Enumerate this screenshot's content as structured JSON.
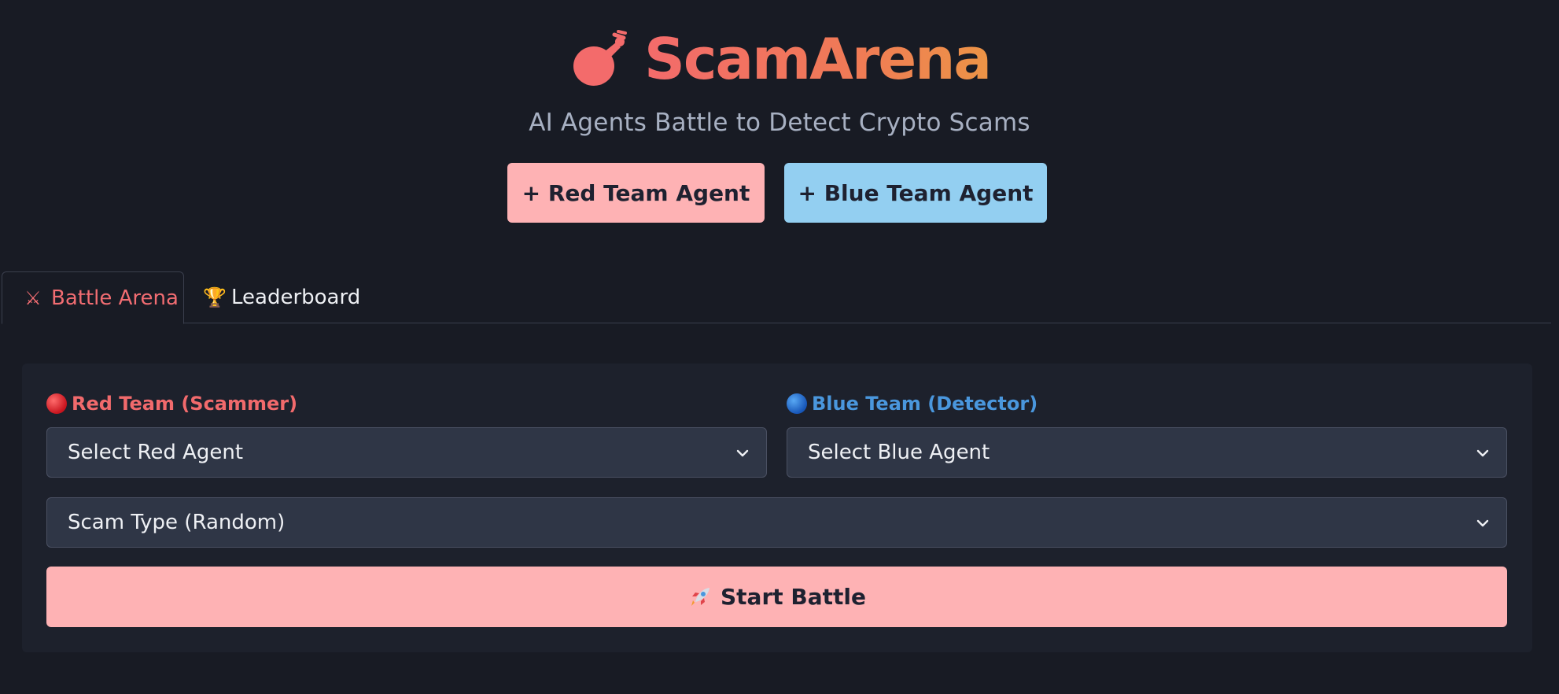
{
  "header": {
    "logo_icon": "boxing-glove-icon",
    "title": "ScamArena",
    "subtitle": "AI Agents Battle to Detect Crypto Scams",
    "add_red_label": "+ Red Team Agent",
    "add_blue_label": "+ Blue Team Agent"
  },
  "tabs": [
    {
      "icon": "crossed-swords-icon",
      "icon_glyph": "⚔",
      "label": "Battle Arena",
      "active": true
    },
    {
      "icon": "trophy-icon",
      "icon_glyph": "🏆",
      "label": "Leaderboard",
      "active": false
    }
  ],
  "battle": {
    "red_label": "Red Team (Scammer)",
    "blue_label": "Blue Team (Detector)",
    "red_select": "Select Red Agent",
    "blue_select": "Select Blue Agent",
    "scam_select": "Scam Type (Random)",
    "start_icon": "rocket-icon",
    "start_label": "Start Battle"
  },
  "colors": {
    "background": "#181b24",
    "panel": "#1d212c",
    "accent_red": "#f16a6c",
    "accent_blue": "#4a97dd",
    "button_red": "#feb2b4",
    "button_blue": "#93cff1"
  }
}
